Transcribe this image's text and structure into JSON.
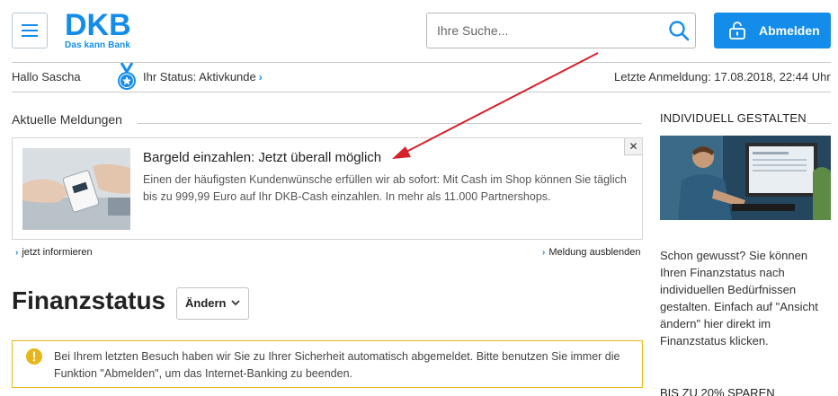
{
  "header": {
    "logo_main": "DKB",
    "logo_sub": "Das kann Bank",
    "search_placeholder": "Ihre Suche...",
    "logout_label": "Abmelden"
  },
  "statusbar": {
    "greeting": "Hallo Sascha",
    "status_label": "Ihr Status: Aktivkunde",
    "last_login": "Letzte Anmeldung: 17.08.2018, 22:44 Uhr"
  },
  "news": {
    "section_title": "Aktuelle Meldungen",
    "headline": "Bargeld einzahlen: Jetzt überall möglich",
    "body": "Einen der häufigsten Kundenwünsche erfüllen wir ab sofort: Mit Cash im Shop können Sie täglich bis zu 999,99 Euro auf Ihr DKB-Cash einzahlen. In mehr als 11.000 Partnershops.",
    "close_label": "✕",
    "inform_link": "jetzt informieren",
    "hide_link": "Meldung ausblenden"
  },
  "finance": {
    "title": "Finanzstatus",
    "change_label": "Ändern"
  },
  "alert": {
    "text": "Bei Ihrem letzten Besuch haben wir Sie zu Ihrer Sicherheit automatisch abgemeldet. Bitte benutzen Sie immer die Funktion \"Abmelden\", um das Internet-Banking zu beenden."
  },
  "sidebar": {
    "title": "INDIVIDUELL GESTALTEN",
    "text": "Schon gewusst? Sie können Ihren Finanzstatus nach individuellen Bedürfnissen gestalten. Einfach auf \"Ansicht ändern\" hier direkt im Finanzstatus klicken.",
    "next_title": "BIS ZU 20% SPAREN"
  },
  "colors": {
    "brand_blue": "#148dea",
    "alert_border": "#e7b71a",
    "annotation_arrow": "#d6202a"
  },
  "icons": [
    "menu-icon",
    "search-icon",
    "lock-icon",
    "medal-icon",
    "close-icon",
    "chevron-down-icon",
    "warning-icon"
  ]
}
